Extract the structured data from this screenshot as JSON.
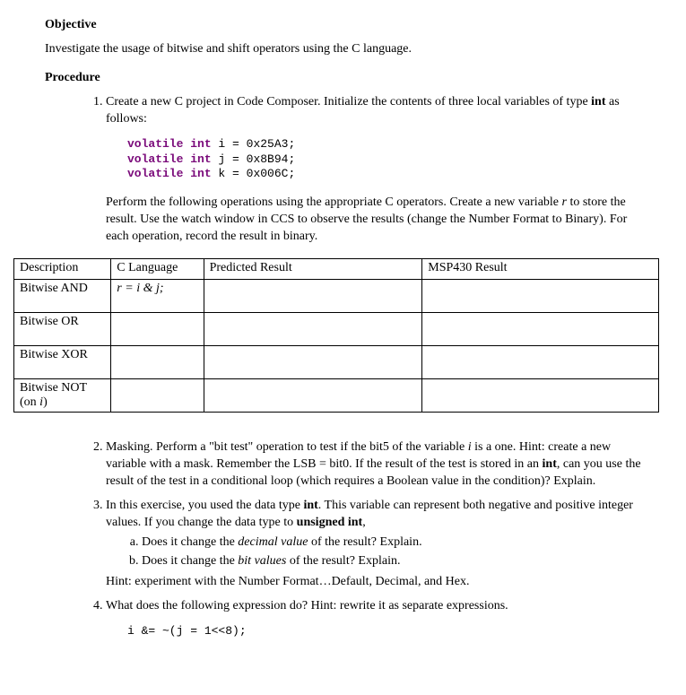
{
  "heading_objective": "Objective",
  "objective_text": "Investigate the usage of bitwise and shift operators using the C language.",
  "heading_procedure": "Procedure",
  "step1": {
    "intro_a": "Create a new C project in Code Composer. Initialize the contents of three local variables of type ",
    "intro_bold": "int",
    "intro_b": " as follows:",
    "code_kw": "volatile int",
    "code_l1_var": " i = ",
    "code_l1_val": "0x25A3",
    "code_l2_var": " j = ",
    "code_l2_val": "0x8B94",
    "code_l3_var": " k = ",
    "code_l3_val": "0x006C",
    "semi": ";",
    "after_a": "Perform the following operations using the appropriate C operators. Create a new variable ",
    "after_r": "r",
    "after_b": " to store the result. Use the watch window in CCS to observe the results (change the Number Format to Binary). For each operation, record the result in binary."
  },
  "table": {
    "hdr_desc": "Description",
    "hdr_lang": "C Language",
    "hdr_pred": "Predicted Result",
    "hdr_msp": "MSP430 Result",
    "rows": [
      {
        "desc": "Bitwise AND",
        "lang_plain": "r = i ",
        "lang_ital": "& j;",
        "pred": "",
        "msp": ""
      },
      {
        "desc": "Bitwise OR",
        "lang_plain": "",
        "lang_ital": "",
        "pred": "",
        "msp": ""
      },
      {
        "desc": "Bitwise XOR",
        "lang_plain": "",
        "lang_ital": "",
        "pred": "",
        "msp": ""
      },
      {
        "desc": "Bitwise NOT (on ",
        "desc_ital": "i",
        "desc_after": ")",
        "lang_plain": "",
        "lang_ital": "",
        "pred": "",
        "msp": ""
      }
    ]
  },
  "step2": {
    "a": "Masking. Perform a \"bit test\" operation to test if the bit5 of the variable ",
    "i": "i",
    "b": " is a one. Hint: create a new variable with a mask. Remember the LSB = bit0. If the result of the test is stored in an ",
    "bold": "int",
    "c": ", can you use the result of the test in a conditional loop (which requires a Boolean value in the condition)? Explain."
  },
  "step3": {
    "a": "In this exercise, you used the data type ",
    "bold1": "int",
    "b": ". This variable can represent both negative and positive integer values. If you change the data type to ",
    "bold2": "unsigned int",
    "c": ",",
    "sub_a1": "Does it change the ",
    "sub_a_ital": "decimal value",
    "sub_a2": " of the result? Explain.",
    "sub_b1": "Does it change the ",
    "sub_b_ital": "bit values",
    "sub_b2": " of the result? Explain.",
    "hint": "Hint: experiment with the Number Format…Default, Decimal, and Hex."
  },
  "step4": {
    "text": "What does the following expression do? Hint: rewrite it as separate expressions.",
    "code": "i &= ~(j = 1<<8);"
  }
}
